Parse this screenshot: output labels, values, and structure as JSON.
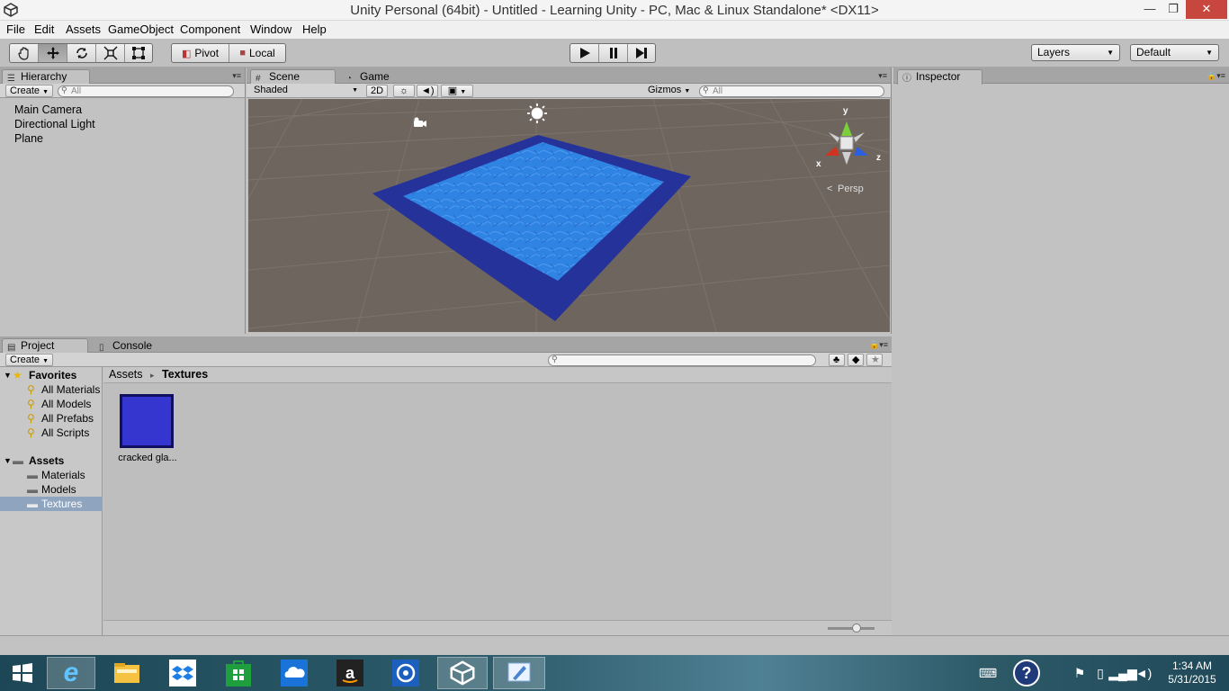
{
  "window": {
    "title": "Unity Personal (64bit) - Untitled - Learning Unity - PC, Mac & Linux Standalone* <DX11>",
    "minimize_glyph": "—",
    "maximize_glyph": "❐",
    "close_glyph": "✕"
  },
  "menu": [
    "File",
    "Edit",
    "Assets",
    "GameObject",
    "Component",
    "Window",
    "Help"
  ],
  "toolbar": {
    "transform_tools": [
      "hand-icon",
      "move-icon",
      "rotate-icon",
      "scale-icon",
      "rect-tool-icon"
    ],
    "pivot_label": "Pivot",
    "local_label": "Local",
    "layers_label": "Layers",
    "layout_label": "Default",
    "colors": {
      "play_arrow": "#111111"
    }
  },
  "hierarchy": {
    "tab_label": "Hierarchy",
    "create_label": "Create",
    "search_placeholder": "All",
    "items": [
      "Main Camera",
      "Directional Light",
      "Plane"
    ]
  },
  "scene": {
    "tab_label": "Scene",
    "game_tab_label": "Game",
    "shading_mode": "Shaded",
    "mode_2d": "2D",
    "gizmos_label": "Gizmos",
    "search_placeholder": "All",
    "persp_label": "Persp",
    "axis_x": "x",
    "axis_y": "y",
    "axis_z": "z",
    "colors": {
      "ground": "#6e655f",
      "plane_outer": "#25329a",
      "plane_inner": "#2e7fe0"
    }
  },
  "inspector": {
    "tab_label": "Inspector"
  },
  "project": {
    "tab_label": "Project",
    "console_tab_label": "Console",
    "create_label": "Create",
    "favorites": {
      "label": "Favorites",
      "items": [
        "All Materials",
        "All Models",
        "All Prefabs",
        "All Scripts"
      ]
    },
    "assets": {
      "label": "Assets",
      "folders": [
        "Materials",
        "Models",
        "Textures"
      ],
      "selected": "Textures"
    },
    "breadcrumb": {
      "root": "Assets",
      "separator": "▸",
      "current": "Textures"
    },
    "files": [
      {
        "name": "cracked gla...",
        "color": "#3535d0"
      }
    ]
  },
  "taskbar": {
    "apps": [
      "internet-explorer-icon",
      "file-explorer-icon",
      "dropbox-icon",
      "store-icon",
      "onedrive-icon",
      "amazon-icon",
      "media-icon",
      "unity-icon",
      "paint-icon"
    ],
    "active_app": "unity-icon",
    "clock": {
      "time": "1:34 AM",
      "date": "5/31/2015"
    }
  }
}
